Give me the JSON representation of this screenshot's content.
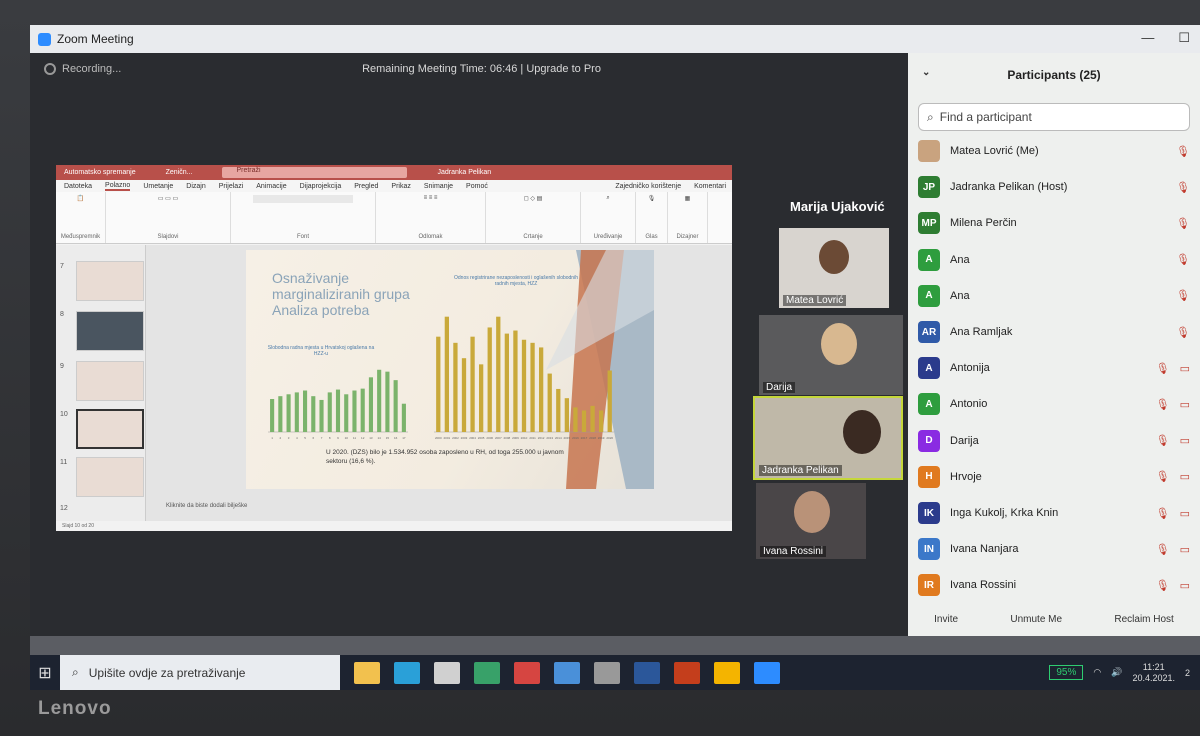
{
  "window": {
    "title": "Zoom Meeting",
    "minimize": "—",
    "maximize": "☐"
  },
  "meeting": {
    "recording": "Recording...",
    "remaining": "Remaining Meeting Time: 06:46 | Upgrade to Pro",
    "speaker": "Marija Ujaković"
  },
  "ppt": {
    "autosave": "Automatsko spremanje",
    "doc": "Zeničn...",
    "search": "Pretraži",
    "user": "Jadranka Pelikan",
    "menu": [
      "Datoteka",
      "Polazno",
      "Umetanje",
      "Dizajn",
      "Prijelazi",
      "Animacije",
      "Dijaprojekcija",
      "Pregled",
      "Prikaz",
      "Snimanje",
      "Pomoć"
    ],
    "share": "Zajedničko korištenje",
    "comments": "Komentari",
    "groups": [
      "Međuspremnik",
      "Slajdovi",
      "Font",
      "Odlomak",
      "Crtanje",
      "Uređivanje",
      "Glas",
      "Dizajner"
    ],
    "slide": {
      "title1": "Osnaživanje",
      "title2": "marginaliziranih grupa",
      "title3": "Analiza potreba",
      "chart1_title": "Slobodna radna mjesta u Hrvatskoj oglašena na HZZ-u",
      "chart2_title": "Odnos registrirane nezaposlenosti i oglašenih slobodnih radnih mjesta, HZZ",
      "text": "U 2020. (DZS) bilo je 1.534.952 osoba zaposleno u RH, od toga 255.000 u javnom sektoru (16,6 %)."
    },
    "notes": "Kliknite da biste dodali bilješke",
    "status": "Slajd 10 od 20",
    "thumb_nums": [
      "7",
      "8",
      "9",
      "10",
      "11",
      "12"
    ]
  },
  "tiles": [
    {
      "name": "Matea Lovrić"
    },
    {
      "name": "Darija"
    },
    {
      "name": "Jadranka Pelikan"
    },
    {
      "name": "Ivana Rossini"
    }
  ],
  "participants": {
    "title": "Participants (25)",
    "search_placeholder": "Find a participant",
    "list": [
      {
        "initials": "",
        "name": "Matea Lovrić (Me)",
        "color": "#c9a37f"
      },
      {
        "initials": "JP",
        "name": "Jadranka Pelikan (Host)",
        "color": "#2e7d32"
      },
      {
        "initials": "MP",
        "name": "Milena Perčin",
        "color": "#2e7d32"
      },
      {
        "initials": "A",
        "name": "Ana",
        "color": "#2e9d3e"
      },
      {
        "initials": "A",
        "name": "Ana",
        "color": "#2e9d3e"
      },
      {
        "initials": "AR",
        "name": "Ana Ramljak",
        "color": "#2f5aa8"
      },
      {
        "initials": "A",
        "name": "Antonija",
        "color": "#2b3b8c"
      },
      {
        "initials": "A",
        "name": "Antonio",
        "color": "#2e9d3e"
      },
      {
        "initials": "D",
        "name": "Darija",
        "color": "#8a2be2"
      },
      {
        "initials": "H",
        "name": "Hrvoje",
        "color": "#e07a1f"
      },
      {
        "initials": "IK",
        "name": "Inga Kukolj,  Krka Knin",
        "color": "#2b3b8c"
      },
      {
        "initials": "IN",
        "name": "Ivana Nanjara",
        "color": "#3b78c9"
      },
      {
        "initials": "IR",
        "name": "Ivana Rossini",
        "color": "#e07a1f"
      }
    ],
    "footer": [
      "Invite",
      "Unmute Me",
      "Reclaim Host"
    ]
  },
  "taskbar": {
    "search": "Upišite ovdje za pretraživanje",
    "battery": "95%",
    "time": "11:21",
    "date": "20.4.2021.",
    "notif": "2"
  },
  "brand": "Lenovo",
  "chart_data": [
    {
      "type": "bar",
      "title": "Slobodna radna mjesta u Hrvatskoj oglašena na HZZ-u",
      "categories": [
        "1",
        "2",
        "3",
        "4",
        "5",
        "6",
        "7",
        "8",
        "9",
        "10",
        "11",
        "12",
        "13",
        "14",
        "15",
        "16",
        "17"
      ],
      "values": [
        35,
        38,
        40,
        42,
        44,
        38,
        34,
        42,
        45,
        40,
        44,
        46,
        58,
        66,
        64,
        55,
        30
      ],
      "color": "#7bb36b"
    },
    {
      "type": "bar",
      "title": "Odnos registrirane nezaposlenosti i oglašenih slobodnih radnih mjesta, HZZ",
      "categories": [
        "2000",
        "2001",
        "2002",
        "2003",
        "2004",
        "2005",
        "2006",
        "2007",
        "2008",
        "2009",
        "2010",
        "2011",
        "2012",
        "2013",
        "2014",
        "2015",
        "2016",
        "2017",
        "2018",
        "2019",
        "2020"
      ],
      "values": [
        0.62,
        0.75,
        0.58,
        0.48,
        0.62,
        0.44,
        0.68,
        0.75,
        0.64,
        0.66,
        0.6,
        0.58,
        0.55,
        0.38,
        0.28,
        0.22,
        0.16,
        0.14,
        0.17,
        0.14,
        0.4
      ],
      "color": "#c9a93a"
    }
  ]
}
